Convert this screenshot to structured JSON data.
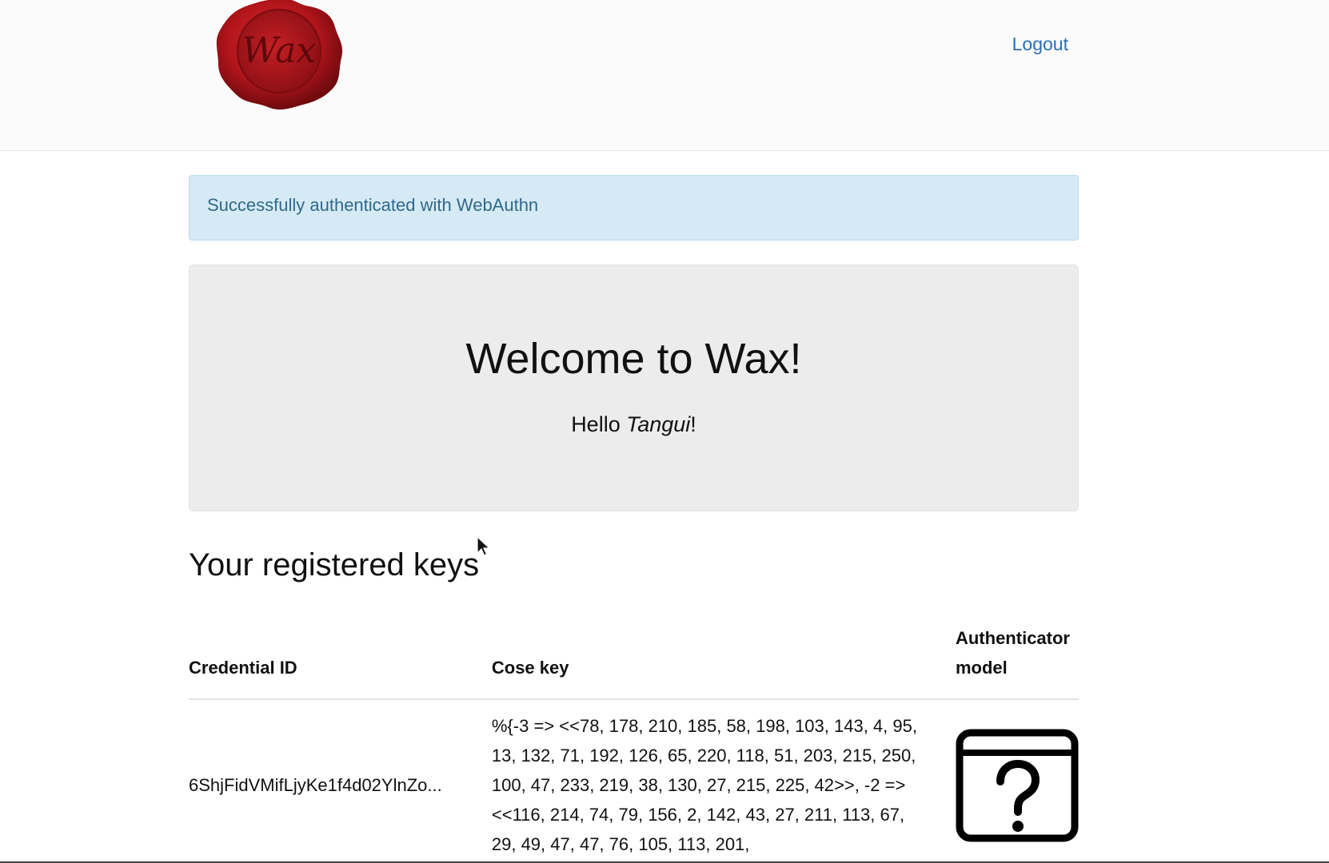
{
  "navbar": {
    "logo_text": "Wax",
    "logout_label": "Logout"
  },
  "alert": {
    "message": "Successfully authenticated with WebAuthn"
  },
  "jumbotron": {
    "title": "Welcome to Wax!",
    "greeting_prefix": "Hello ",
    "username": "Tangui",
    "greeting_suffix": "!"
  },
  "keys_section": {
    "title": "Your registered keys",
    "columns": {
      "credential_id": "Credential ID",
      "cose_key": "Cose key",
      "authenticator_model": "Authenticator model"
    },
    "rows": [
      {
        "credential_id": "6ShjFidVMifLjyKe1f4d02YlnZo...",
        "cose_key": "%{-3 => <<78, 178, 210, 185, 58, 198, 103, 143, 4, 95, 13, 132, 71, 192, 126, 65, 220, 118, 51, 203, 215, 250, 100, 47, 233, 219, 38, 130, 27, 215, 225, 42>>, -2 => <<116, 214, 74, 79, 156, 2, 142, 43, 27, 211, 113, 67, 29, 49, 47, 47, 76, 105, 113, 201,",
        "model_icon": "unknown-authenticator-icon"
      }
    ]
  },
  "colors": {
    "link": "#2a6fb3",
    "alert_bg": "#d6eaf5",
    "alert_text": "#2e6a8a",
    "jumbotron_bg": "#ececec",
    "seal_red": "#b3151b"
  }
}
